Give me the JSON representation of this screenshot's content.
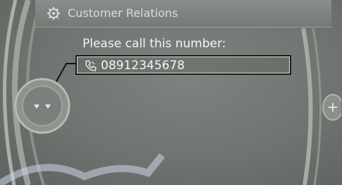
{
  "header": {
    "icon": "gear-icon",
    "title": "Customer Relations"
  },
  "dialog": {
    "prompt": "Please call this number:",
    "phone_icon": "phone-icon",
    "phone_number": "08912345678"
  },
  "colors": {
    "screen_bg": "#707470",
    "text": "#f2f4f2",
    "header_text": "#d9ddd9",
    "selection_border": "#1a1c1a"
  }
}
